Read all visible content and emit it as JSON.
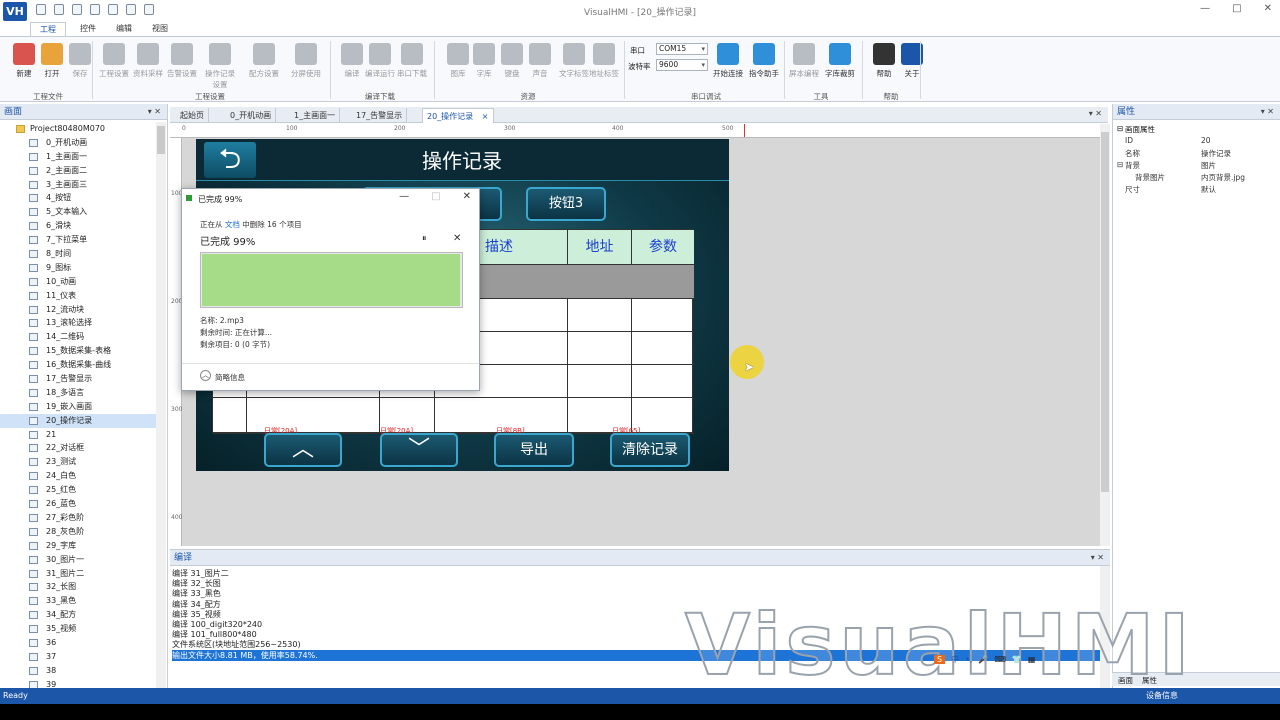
{
  "window": {
    "logo": "VH",
    "title": "VisualHMI - [20_操作记录]",
    "controls": [
      "—",
      "□",
      "✕"
    ]
  },
  "ribbon_tabs": [
    "工程",
    "控件",
    "编辑",
    "视图"
  ],
  "ribbon": {
    "buttons": [
      {
        "label": "新建",
        "enabled": true,
        "color": "#d9534f"
      },
      {
        "label": "打开",
        "enabled": true,
        "color": "#e8a33b"
      },
      {
        "label": "保存",
        "enabled": false
      },
      {
        "label": "工程设置",
        "enabled": false
      },
      {
        "label": "资料采样",
        "enabled": false
      },
      {
        "label": "告警设置",
        "enabled": false
      },
      {
        "label": "操作记录设置",
        "enabled": false
      },
      {
        "label": "配方设置",
        "enabled": false
      },
      {
        "label": "分屏使用",
        "enabled": false
      },
      {
        "label": "编译",
        "enabled": false
      },
      {
        "label": "编译运行",
        "enabled": false
      },
      {
        "label": "串口下载",
        "enabled": false
      },
      {
        "label": "图库",
        "enabled": false
      },
      {
        "label": "字库",
        "enabled": false
      },
      {
        "label": "键盘",
        "enabled": false
      },
      {
        "label": "声音",
        "enabled": false
      },
      {
        "label": "文字标签",
        "enabled": false
      },
      {
        "label": "地址标签",
        "enabled": false
      },
      {
        "label": "开始连接",
        "enabled": true,
        "color": "#2f8fd8"
      },
      {
        "label": "指令助手",
        "enabled": true,
        "color": "#2f8fd8"
      },
      {
        "label": "屏本编程",
        "enabled": false
      },
      {
        "label": "字库裁剪",
        "enabled": true,
        "color": "#2f8fd8"
      },
      {
        "label": "帮助",
        "enabled": true,
        "color": "#333333"
      },
      {
        "label": "关于",
        "enabled": true,
        "color": "#1b56a8"
      }
    ],
    "groups": [
      "工程文件",
      "工程设置",
      "编译下载",
      "资源",
      "串口调试",
      "工具",
      "帮助"
    ],
    "serial": {
      "port_label": "串口",
      "port_value": "COM15",
      "baud_label": "波特率",
      "baud_value": "9600"
    }
  },
  "left_panel": {
    "title": "画面",
    "pin": "▾ ✕",
    "items": [
      "Project80480M070",
      "0_开机动画",
      "1_主画面一",
      "2_主画面二",
      "3_主画面三",
      "4_按钮",
      "5_文本输入",
      "6_滑块",
      "7_下拉菜单",
      "8_时间",
      "9_图标",
      "10_动画",
      "11_仪表",
      "12_流动块",
      "13_滚轮选择",
      "14_二维码",
      "15_数据采集-表格",
      "16_数据采集-曲线",
      "17_告警显示",
      "18_多语言",
      "19_嵌入画面",
      "20_操作记录",
      "21",
      "22_对话框",
      "23_测试",
      "24_白色",
      "25_红色",
      "26_蓝色",
      "27_彩色阶",
      "28_灰色阶",
      "29_字库",
      "30_图片一",
      "31_图片二",
      "32_长图",
      "33_黑色",
      "34_配方",
      "35_视频",
      "36",
      "37",
      "38",
      "39"
    ],
    "selected": "20_操作记录"
  },
  "doc_tabs": [
    "起始页",
    "0_开机动画",
    "1_主画面一",
    "17_告警显示",
    "20_操作记录"
  ],
  "doc_tab_close": "×",
  "doc_tabs_right": "▾ ✕",
  "rulers": {
    "top": [
      "0",
      "100",
      "200",
      "300",
      "400",
      "500"
    ],
    "left": [
      "100",
      "200",
      "300",
      "400"
    ]
  },
  "hmi": {
    "back_icon": "⮌",
    "title": "操作记录",
    "top_buttons": [
      "按钮3"
    ],
    "table_headers": [
      "描述",
      "地址",
      "参数"
    ],
    "red_labels": [
      "日常[20A]",
      "日常[20A]",
      "日常[8B]",
      "日常[65]"
    ],
    "bottom_buttons": {
      "up": "︿",
      "down": "﹀",
      "export": "导出",
      "clear": "清除记录"
    }
  },
  "dialog": {
    "title": "已完成 99%",
    "controls": [
      "—",
      "□",
      "✕"
    ],
    "line1_pre": "正在从",
    "line1_link": "文档",
    "line1_post": "中删除 16 个项目",
    "percent": "已完成 99%",
    "pause": "⏸",
    "cancel": "✕",
    "progress": 0.99,
    "name": "名称: 2.mp3",
    "remaining_time": "剩余时间: 正在计算...",
    "remaining_items": "剩余项目: 0 (0 字节)",
    "more_info": "简略信息",
    "more_icon": "︿"
  },
  "properties": {
    "title": "属性",
    "pin": "▾ ✕",
    "rows": [
      {
        "k": "画面属性",
        "v": "",
        "group": true,
        "prefix": "⊟"
      },
      {
        "k": "ID",
        "v": "20",
        "group": false,
        "prefix": ""
      },
      {
        "k": "名称",
        "v": "操作记录",
        "group": false,
        "prefix": ""
      },
      {
        "k": "背景",
        "v": "图片",
        "group": false,
        "prefix": "⊟"
      },
      {
        "k": "背景图片",
        "v": "内页背景.jpg",
        "group": false,
        "prefix": "",
        "indent": true
      },
      {
        "k": "尺寸",
        "v": "默认",
        "group": false,
        "prefix": ""
      }
    ],
    "bottom_tabs": [
      "画面",
      "属性",
      "设备信息"
    ]
  },
  "output": {
    "title": "编译",
    "pin": "▾ ✕",
    "lines": [
      "编译 31_图片二",
      "编译 32_长图",
      "编译 33_黑色",
      "编译 34_配方",
      "编译 35_视频",
      "编译 100_digit320*240",
      "编译 101_full800*480",
      "文件系统区(块地址范围256~2530)",
      "输出文件大小8.81 MB，使用率58.74%."
    ]
  },
  "watermark": "VisualHMI",
  "ime": [
    "S",
    "中",
    "•,",
    "🎤",
    "⌨",
    "👕",
    "▦"
  ],
  "status": {
    "left": "Ready"
  },
  "cursor": "➤"
}
